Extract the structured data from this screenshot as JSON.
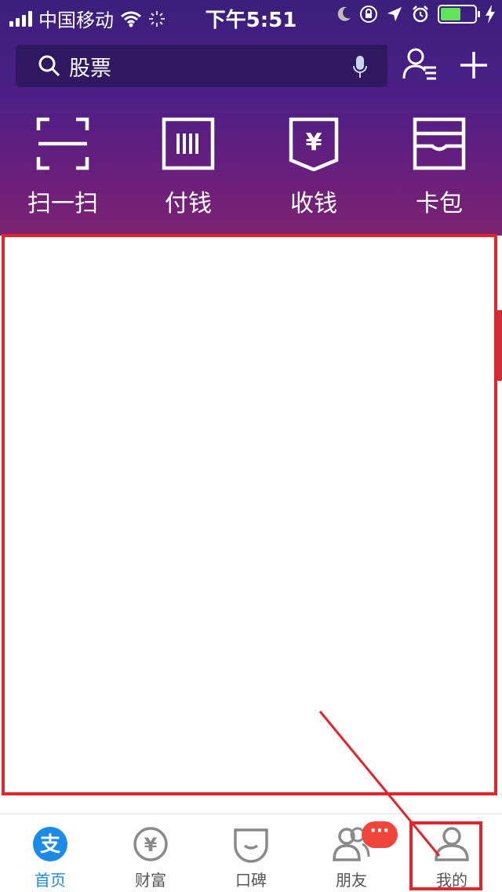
{
  "status_bar": {
    "carrier": "中国移动",
    "time": "下午5:51"
  },
  "header": {
    "search_text": "股票"
  },
  "quick_actions": [
    {
      "label": "扫一扫",
      "icon": "scan-icon"
    },
    {
      "label": "付钱",
      "icon": "pay-barcode-icon"
    },
    {
      "label": "收钱",
      "icon": "receive-yuan-icon"
    },
    {
      "label": "卡包",
      "icon": "card-wallet-icon"
    }
  ],
  "tabbar": {
    "tabs": [
      {
        "label": "首页",
        "icon": "alipay-home-icon",
        "active": true
      },
      {
        "label": "财富",
        "icon": "wealth-yuan-icon",
        "active": false
      },
      {
        "label": "口碑",
        "icon": "koubei-icon",
        "active": false
      },
      {
        "label": "朋友",
        "icon": "friends-icon",
        "active": false
      },
      {
        "label": "我的",
        "icon": "profile-icon",
        "active": false
      }
    ],
    "friends_badge": "···"
  },
  "colors": {
    "header_top": "#3a1f7c",
    "header_bottom": "#7b2470",
    "accent_blue": "#1c8ae6",
    "highlight_red": "#e0262c",
    "badge_red": "#f0453b"
  }
}
